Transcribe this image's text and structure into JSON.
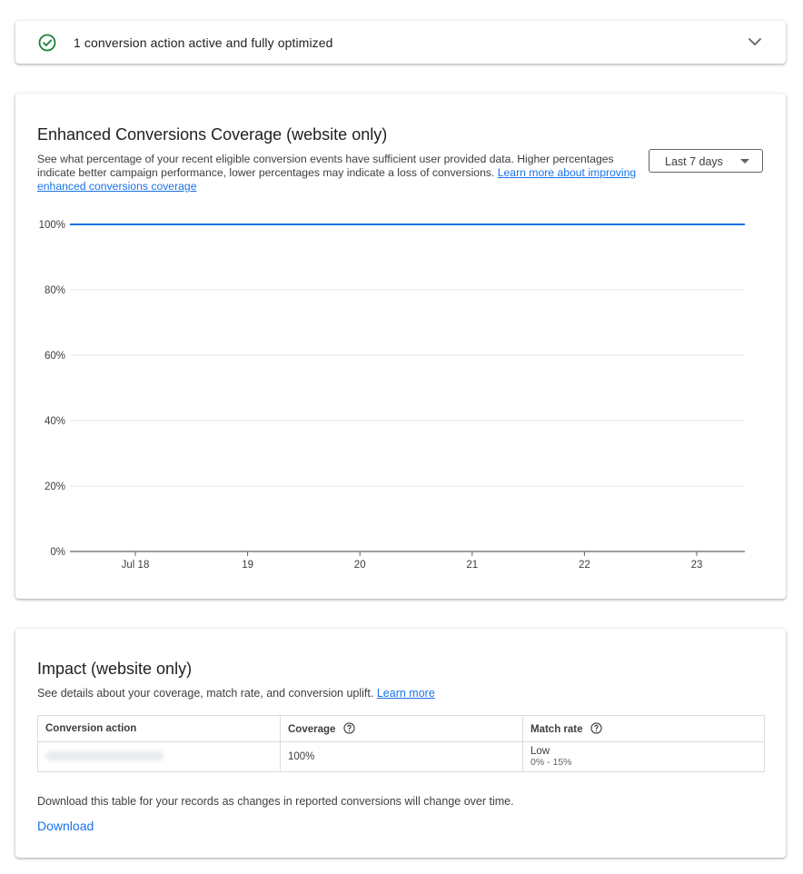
{
  "status": {
    "text": "1 conversion action active and fully optimized"
  },
  "coverage": {
    "title": "Enhanced Conversions Coverage (website only)",
    "description": "See what percentage of your recent eligible conversion events have sufficient user provided data. Higher percentages indicate better campaign performance, lower percentages may indicate a loss of conversions.",
    "learn_link": "Learn more about improving enhanced conversions coverage",
    "range_select": "Last 7 days"
  },
  "chart_data": {
    "type": "line",
    "x": [
      "Jul 18",
      "19",
      "20",
      "21",
      "22",
      "23"
    ],
    "y_ticks": [
      "0%",
      "20%",
      "40%",
      "60%",
      "80%",
      "100%"
    ],
    "ylim": [
      0,
      100
    ],
    "series": [
      {
        "values": [
          100,
          100,
          100,
          100,
          100,
          100
        ],
        "color": "#1a73e8"
      }
    ],
    "grid": true
  },
  "impact": {
    "title": "Impact (website only)",
    "description": "See details about your coverage, match rate, and conversion uplift.",
    "learn_link": "Learn more",
    "columns": [
      "Conversion action",
      "Coverage",
      "Match rate"
    ],
    "row": {
      "coverage": "100%",
      "match_rate": "Low",
      "match_range": "0% - 15%"
    },
    "download_note": "Download this table for your records as changes in reported conversions will change over time.",
    "download_label": "Download"
  },
  "colors": {
    "accent": "#1a73e8",
    "success": "#188038"
  }
}
